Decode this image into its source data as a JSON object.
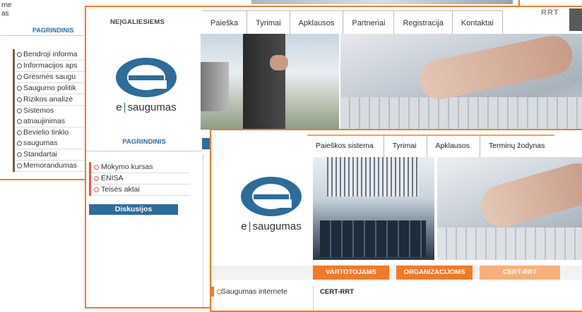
{
  "back": {
    "fragment_lines": [
      "rne",
      "as"
    ],
    "section": "PAGRINDINIS",
    "items": [
      "Bendroji informa",
      "Informacijos aps",
      "Grėsmės saugu",
      "Saugumo politik",
      "Rizikos analizė",
      "Sistemos",
      "atnaujinimas",
      "Bevielio tinklo",
      "saugumas",
      "Standartai",
      "Memorandumas"
    ]
  },
  "mid": {
    "audience": "NEĮGALIESIEMS",
    "nav": [
      "Paieška",
      "Tyrimai",
      "Apklausos",
      "Partneriai",
      "Registracija",
      "Kontaktai"
    ],
    "logo_left": "e",
    "logo_right": "saugumas",
    "section": "PAGRINDINIS",
    "items": [
      "Mokymo kursas",
      "ENISA",
      "Teisės aktai"
    ],
    "discuss": "Diskusijos",
    "badge": "RRT"
  },
  "front": {
    "nav": [
      "Paieškos sistema",
      "Tyrimai",
      "Apklausos",
      "Terminų žodynas"
    ],
    "logo_left": "e",
    "logo_right": "saugumas",
    "tabs": [
      "VARTOTOJAMS",
      "ORGANIZACIJOMS",
      "CERT-RRT"
    ],
    "left_item": "Saugumas internete",
    "cert_heading": "CERT-RRT"
  },
  "colors": {
    "accent": "#f07a2a",
    "brand_blue": "#2e6c99",
    "section_blue": "#2d6aa3"
  }
}
